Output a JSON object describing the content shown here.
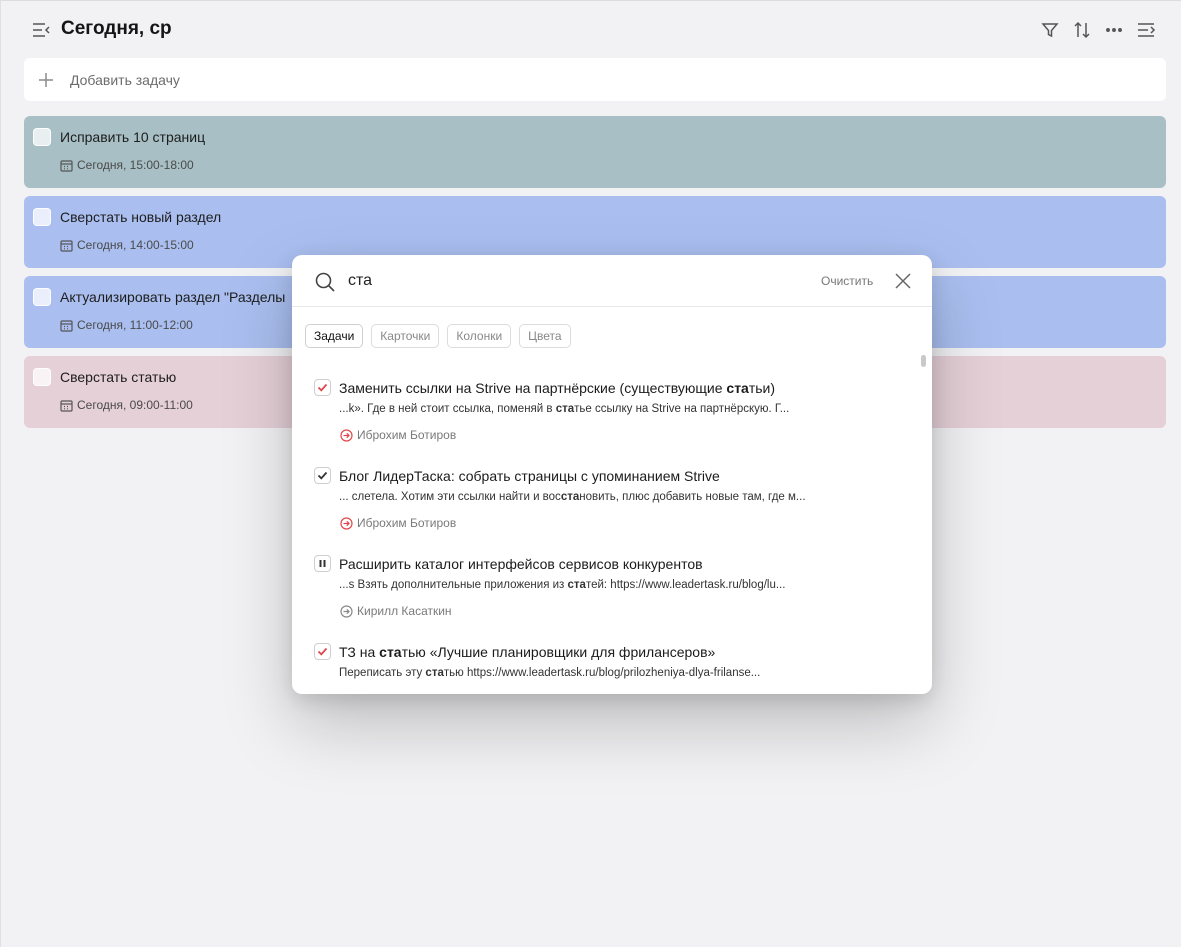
{
  "header": {
    "title": "Сегодня, ср"
  },
  "add_task": {
    "label": "Добавить задачу"
  },
  "tasks": [
    {
      "name": "Исправить 10 страниц",
      "date": "Сегодня, 15:00-18:00",
      "color": "#a8c0c5"
    },
    {
      "name": "Сверстать новый раздел",
      "date": "Сегодня, 14:00-15:00",
      "color": "#aabff0"
    },
    {
      "name": "Актуализировать раздел \"Разделы",
      "date": "Сегодня, 11:00-12:00",
      "color": "#aabff0"
    },
    {
      "name": "Сверстать статью",
      "date": "Сегодня, 09:00-11:00",
      "color": "#e6d0d8"
    }
  ],
  "search": {
    "query": "ста",
    "clear_label": "Очистить",
    "filters": [
      "Задачи",
      "Карточки",
      "Колонки",
      "Цвета"
    ],
    "active_filter": "Задачи"
  },
  "results": [
    {
      "status_icon": "check-red",
      "title_pre": "Заменить ссылки на Strive на партнёрские (существующие ",
      "title_hl": "ста",
      "title_post": "тьи)",
      "snip_pre": "...k». Где в ней стоит ссылка, поменяй в ",
      "snip_hl": "ста",
      "snip_post": "тье ссылку на Strive на партнёрскую. Г...",
      "owner": "Иброхим Ботиров",
      "owner_color": "#e0474c"
    },
    {
      "status_icon": "check-dark",
      "title_pre": "Блог ЛидерТаска: собрать страницы с упоминанием Strive",
      "title_hl": "",
      "title_post": "",
      "snip_pre": "... слетела. Хотим эти ссылки найти и вос",
      "snip_hl": "ста",
      "snip_post": "новить, плюс добавить новые там, где м...",
      "owner": "Иброхим Ботиров",
      "owner_color": "#e0474c"
    },
    {
      "status_icon": "pause",
      "title_pre": "Расширить каталог интерфейсов сервисов конкурентов",
      "title_hl": "",
      "title_post": "",
      "snip_pre": "...s Взять дополнительные приложения из ",
      "snip_hl": "ста",
      "snip_post": "тей: https://www.leadertask.ru/blog/lu...",
      "owner": "Кирилл Касаткин",
      "owner_color": "#888888"
    },
    {
      "status_icon": "check-red",
      "title_pre": "ТЗ на ",
      "title_hl": "ста",
      "title_post": "тью «Лучшие планировщики для фрилансеров»",
      "snip_pre": "Переписать эту ",
      "snip_hl": "ста",
      "snip_post": "тью https://www.leadertask.ru/blog/prilozheniya-dlya-frilanse...",
      "owner": "",
      "owner_color": "#e0474c"
    }
  ]
}
